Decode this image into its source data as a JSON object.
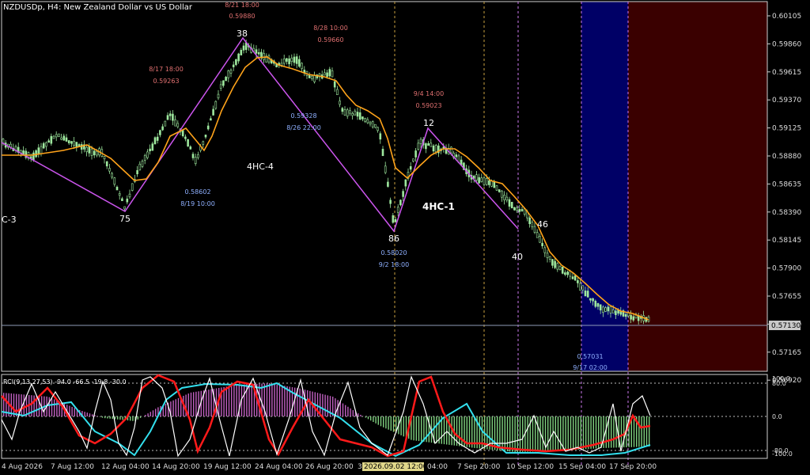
{
  "chart": {
    "title": "NZDUSDp, H4:  New Zealand Dollar vs US Dollar",
    "current_price": "0.57130",
    "price_ticks": [
      "0.60105",
      "0.59860",
      "0.59615",
      "0.59370",
      "0.59125",
      "0.58880",
      "0.58635",
      "0.58390",
      "0.58145",
      "0.57900",
      "0.57655",
      "0.57410",
      "0.57165",
      "0.56920"
    ],
    "date_ticks": [
      "4 Aug 2026",
      "7 Aug 12:00",
      "12 Aug 04:00",
      "14 Aug 20:00",
      "19 Aug 12:00",
      "24 Aug 04:00",
      "26 Aug 20:00",
      "31",
      "2026.09.02 12:00",
      "04:00",
      "7 Sep 20:00",
      "10 Sep 12:00",
      "15 Sep 04:00",
      "17 Sep 20:00"
    ]
  },
  "annotations": {
    "swing_labels": [
      "38",
      "75",
      "86",
      "12",
      "40",
      "46",
      "C-3"
    ],
    "wave_labels": [
      "4HC-4",
      "4HC-1"
    ],
    "price_notes": [
      {
        "date": "8/21 18:00",
        "price": "0.59880"
      },
      {
        "date": "8/28 10:00",
        "price": "0.59660"
      },
      {
        "date": "8/17 18:00",
        "price": "0.59263"
      },
      {
        "date": "9/4 14:00",
        "price": "0.59023"
      },
      {
        "date": "8/26 22:00",
        "price": "0.59328"
      },
      {
        "date": "8/19 10:00",
        "price": "0.58602"
      },
      {
        "date": "9/2 18:00",
        "price": "0.58020"
      },
      {
        "date": "9/17 02:00",
        "price": "0.57031"
      }
    ]
  },
  "indicator": {
    "label": "RCI(9,13,27,53) -94.0 -66.5 -19.8 -30.0",
    "levels": [
      "100.0",
      "80.0",
      "0.0",
      "-80.0",
      "-100.0"
    ]
  },
  "colors": {
    "background": "#000000",
    "candle": "#9ee89e",
    "moving_average": "#ffa31a",
    "zigzag": "#cc55ee",
    "grid": "#cccccc",
    "session_blue": "#000066",
    "session_red": "#3a0000",
    "note_red": "#e07070",
    "note_blue": "#8fb0ff",
    "rci_white": "#ffffff",
    "rci_red": "#ff1a1a",
    "rci_cyan": "#33e0ee",
    "hist_pos": "#7fd07f",
    "hist_neg": "#c060c0"
  }
}
